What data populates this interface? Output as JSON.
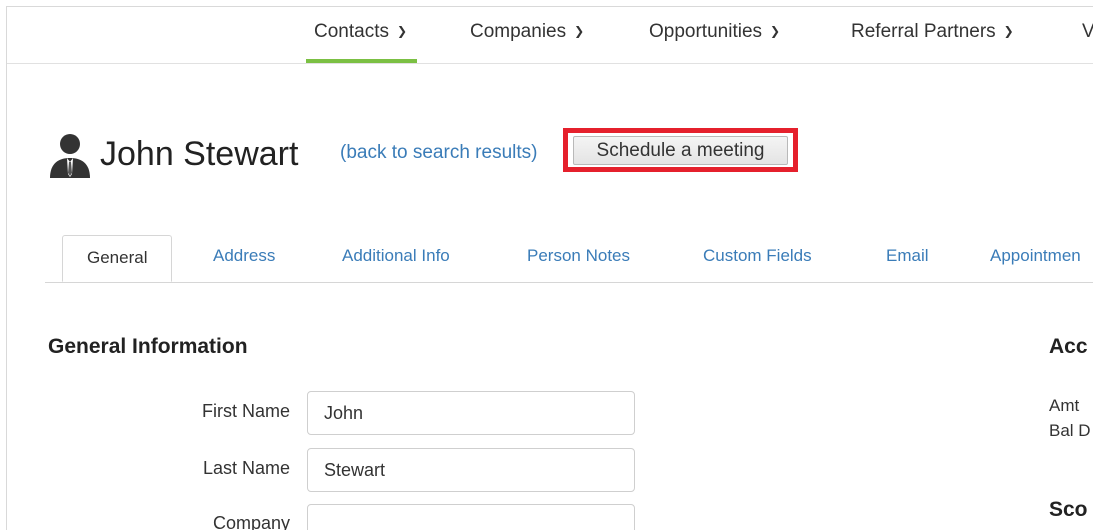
{
  "nav": {
    "items": [
      {
        "label": "Contacts",
        "active": true
      },
      {
        "label": "Companies",
        "active": false
      },
      {
        "label": "Opportunities",
        "active": false
      },
      {
        "label": "Referral Partners",
        "active": false
      },
      {
        "label": "V",
        "active": false
      }
    ],
    "chevron": "⌄"
  },
  "header": {
    "icon": "person-silhouette-icon",
    "name": "John Stewart",
    "back_link": "(back to search results)",
    "schedule_button": "Schedule a meeting",
    "highlight_color": "#e5202c"
  },
  "tabs": [
    {
      "label": "General",
      "active": true
    },
    {
      "label": "Address",
      "active": false
    },
    {
      "label": "Additional Info",
      "active": false
    },
    {
      "label": "Person Notes",
      "active": false
    },
    {
      "label": "Custom Fields",
      "active": false
    },
    {
      "label": "Email",
      "active": false
    },
    {
      "label": "Appointmen",
      "active": false
    }
  ],
  "general": {
    "title": "General Information",
    "fields": [
      {
        "label": "First Name",
        "value": "John"
      },
      {
        "label": "Last Name",
        "value": "Stewart"
      },
      {
        "label": "Company",
        "value": ""
      }
    ]
  },
  "right_panel": {
    "title1": "Acc",
    "line1": "Amt",
    "line2": "Bal D",
    "title2": "Sco"
  },
  "colors": {
    "accent": "#7bc043",
    "link": "#3a7cb8"
  }
}
